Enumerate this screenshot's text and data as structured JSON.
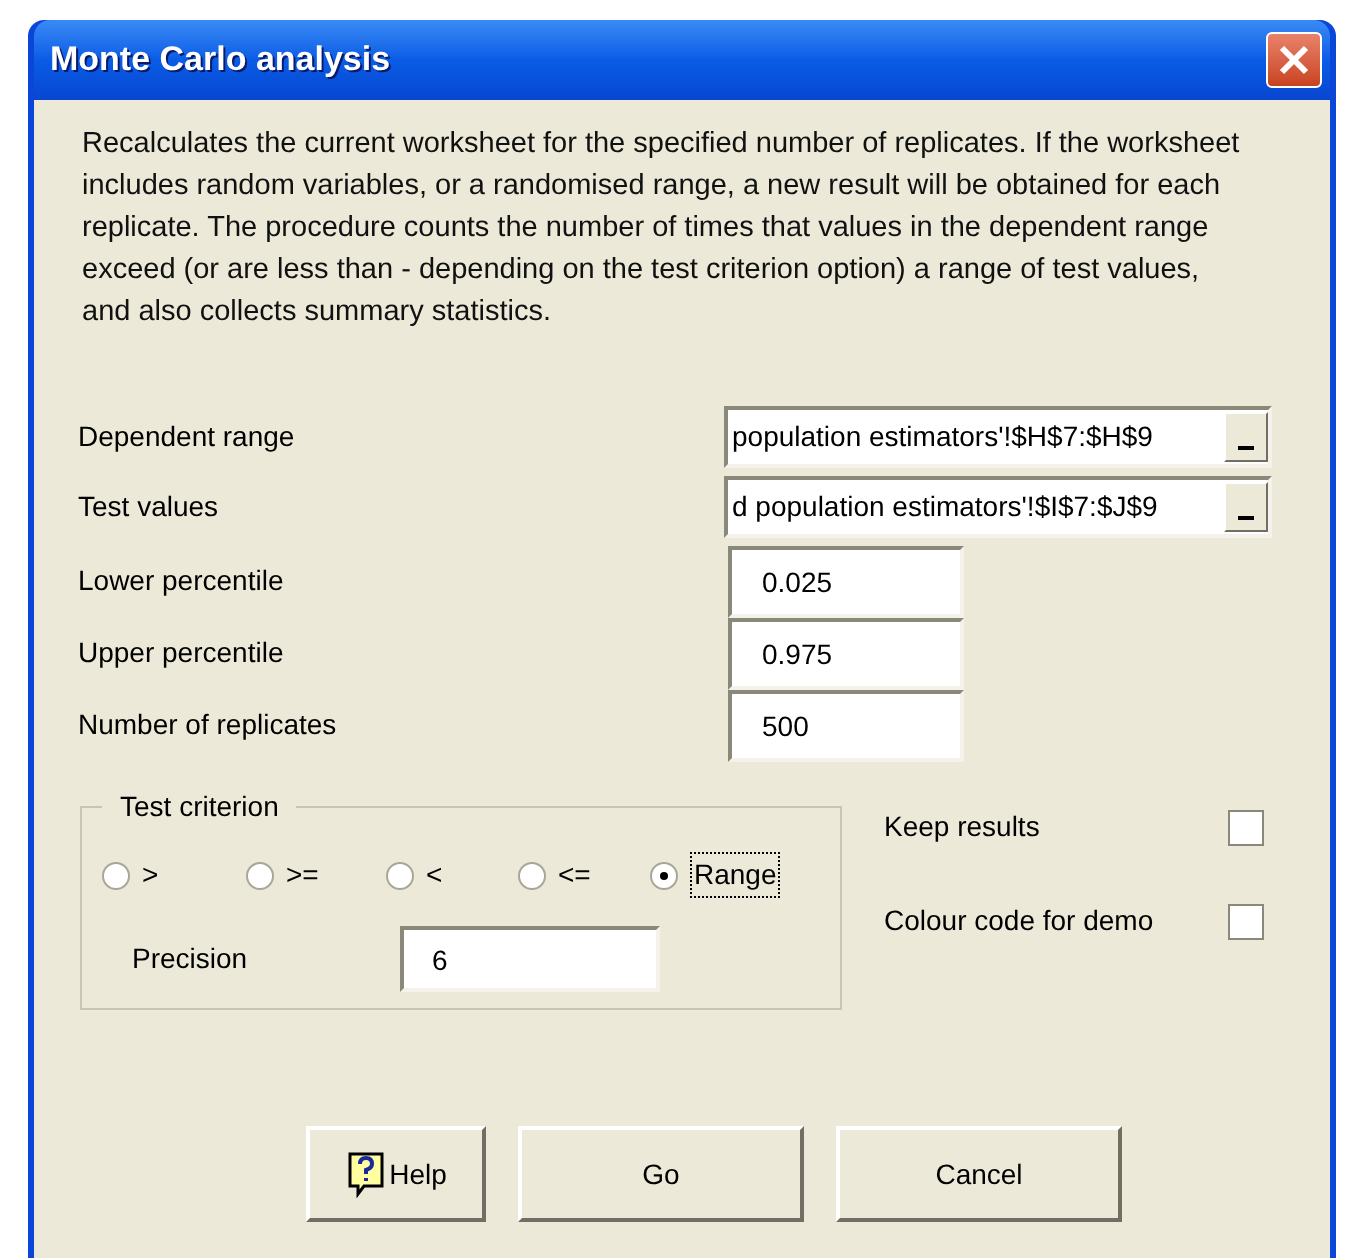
{
  "window": {
    "title": "Monte Carlo analysis"
  },
  "description": "Recalculates the current worksheet for the specified number of replicates. If the worksheet includes random variables, or a randomised range, a new result will be obtained for each replicate. The procedure counts the number of times that values in the dependent range exceed (or are less than - depending on the test criterion option) a range of test values, and also collects summary statistics.",
  "ref_fields": [
    {
      "label": "Dependent range",
      "value": "population estimators'!$H$7:$H$9"
    },
    {
      "label": "Test values",
      "value": "d population estimators'!$I$7:$J$9"
    }
  ],
  "number_fields": [
    {
      "label": "Lower percentile",
      "value": "0.025"
    },
    {
      "label": "Upper percentile",
      "value": "0.975"
    },
    {
      "label": "Number of replicates",
      "value": "500"
    }
  ],
  "test_criterion": {
    "title": "Test criterion",
    "options": [
      {
        "label": ">",
        "selected": false
      },
      {
        "label": ">=",
        "selected": false
      },
      {
        "label": "<",
        "selected": false
      },
      {
        "label": "<=",
        "selected": false
      },
      {
        "label": "Range",
        "selected": true
      }
    ],
    "precision": {
      "label": "Precision",
      "value": "6"
    }
  },
  "options": [
    {
      "label": "Keep results",
      "checked": false
    },
    {
      "label": "Colour code for demo",
      "checked": false
    }
  ],
  "buttons": [
    {
      "label": "Help",
      "kind": "help"
    },
    {
      "label": "Go",
      "kind": "plain"
    },
    {
      "label": "Cancel",
      "kind": "plain"
    }
  ]
}
